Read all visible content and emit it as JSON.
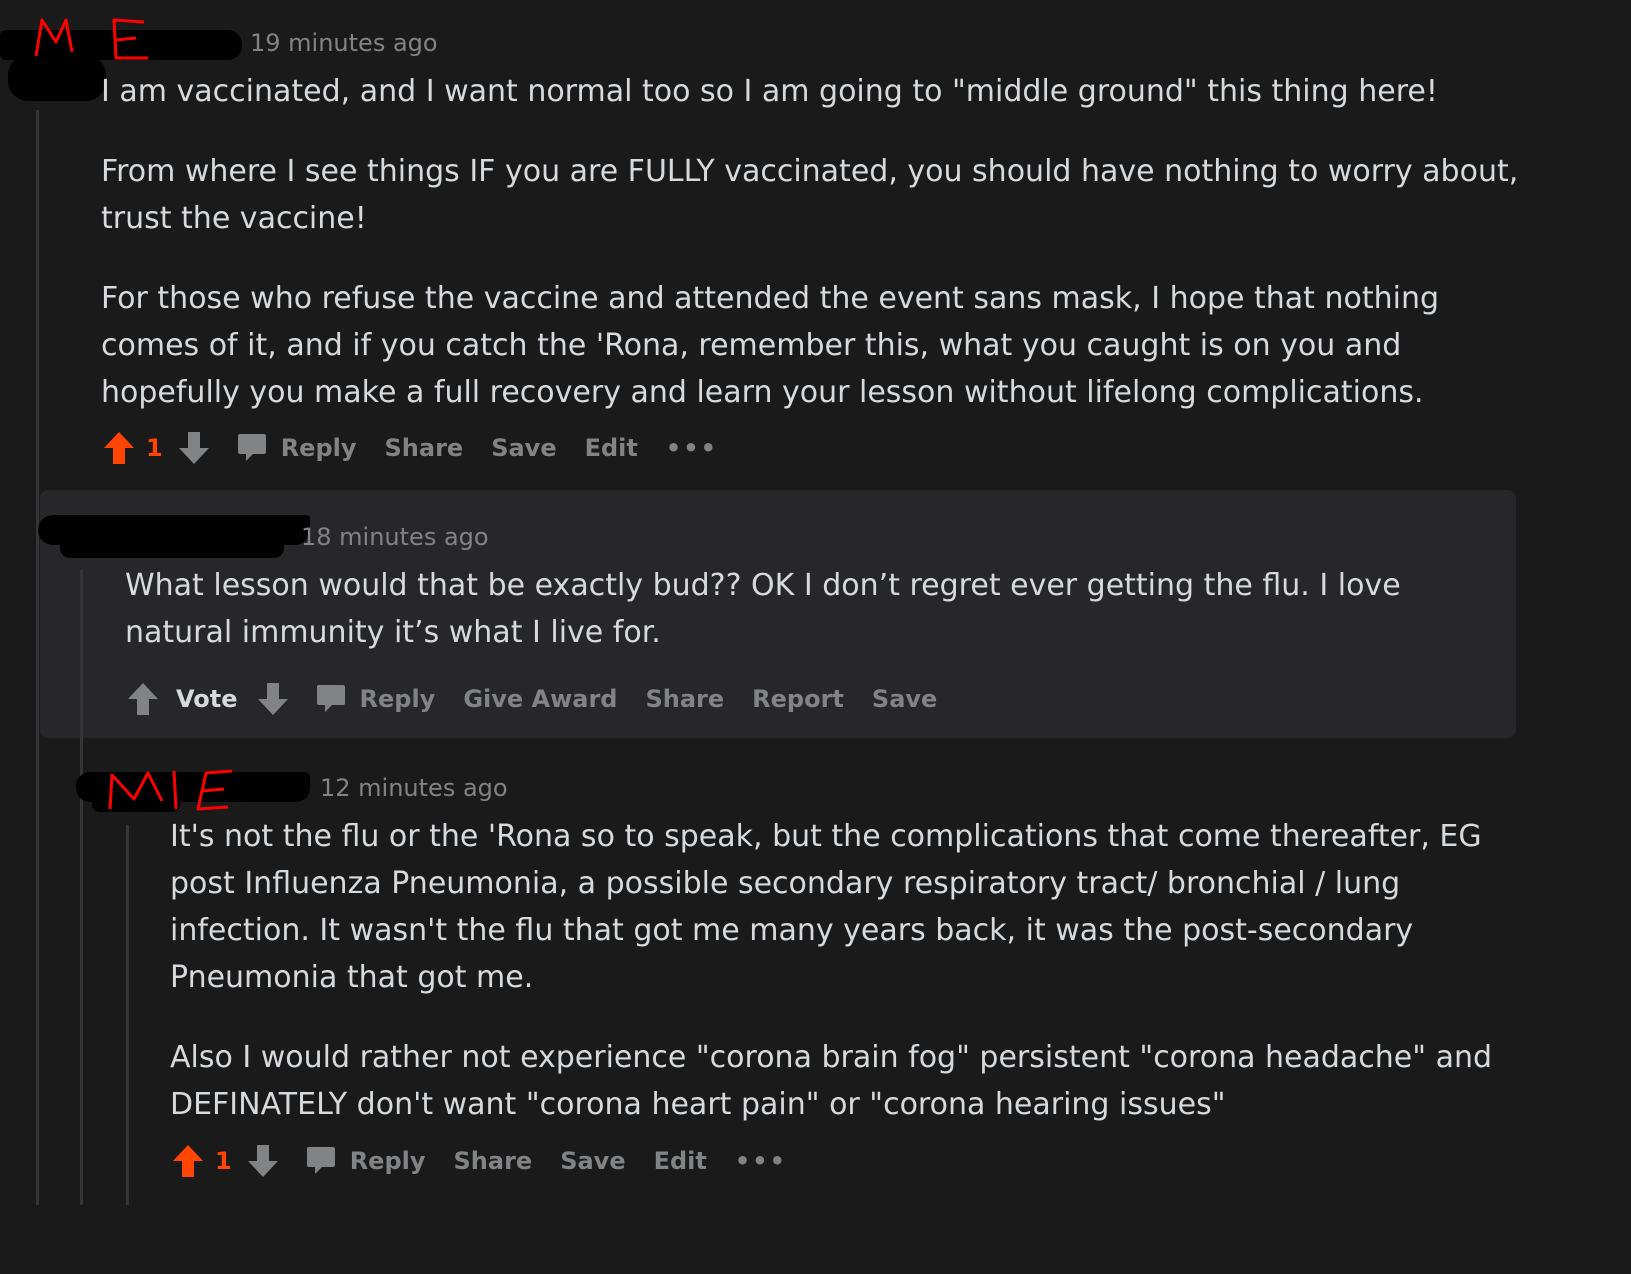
{
  "theme": {
    "background": "#1a1a1b",
    "highlight": "#272729",
    "text": "#d7dadc",
    "muted": "#818384",
    "upvote": "#ff4500",
    "annotation": "#ff0000"
  },
  "comments": [
    {
      "annotation": "M E",
      "time": "19 minutes ago",
      "paragraphs": [
        "I am vaccinated, and I want normal too so I am going to \"middle ground\" this thing here!",
        "From where I see things IF you are FULLY vaccinated, you should have nothing to worry about, trust the vaccine!",
        "For those who refuse the vaccine and attended the event sans mask, I hope that nothing comes of it, and if you catch the 'Rona, remember this, what you caught is on you and hopefully you make a full recovery and learn your lesson without lifelong complications."
      ],
      "score": "1",
      "upvoted": true,
      "actions": [
        "Reply",
        "Share",
        "Save",
        "Edit"
      ],
      "more": "•••"
    },
    {
      "time": "18 minutes ago",
      "paragraphs": [
        "What lesson would that be exactly bud?? OK I don’t regret ever getting the flu. I love natural immunity it’s what I live for."
      ],
      "score": "Vote",
      "upvoted": false,
      "actions": [
        "Reply",
        "Give Award",
        "Share",
        "Report",
        "Save"
      ]
    },
    {
      "annotation": "ME",
      "time": "12 minutes ago",
      "paragraphs": [
        "It's not the flu or the 'Rona so to speak, but the complications that come thereafter, EG post Influenza Pneumonia, a possible secondary respiratory tract/ bronchial / lung infection. It wasn't the flu that got me many years back, it was the post-secondary Pneumonia that got me.",
        "Also I would rather not experience \"corona brain fog\" persistent \"corona headache\" and DEFINATELY don't want \"corona heart pain\" or \"corona hearing issues\""
      ],
      "score": "1",
      "upvoted": true,
      "actions": [
        "Reply",
        "Share",
        "Save",
        "Edit"
      ],
      "more": "•••"
    }
  ]
}
